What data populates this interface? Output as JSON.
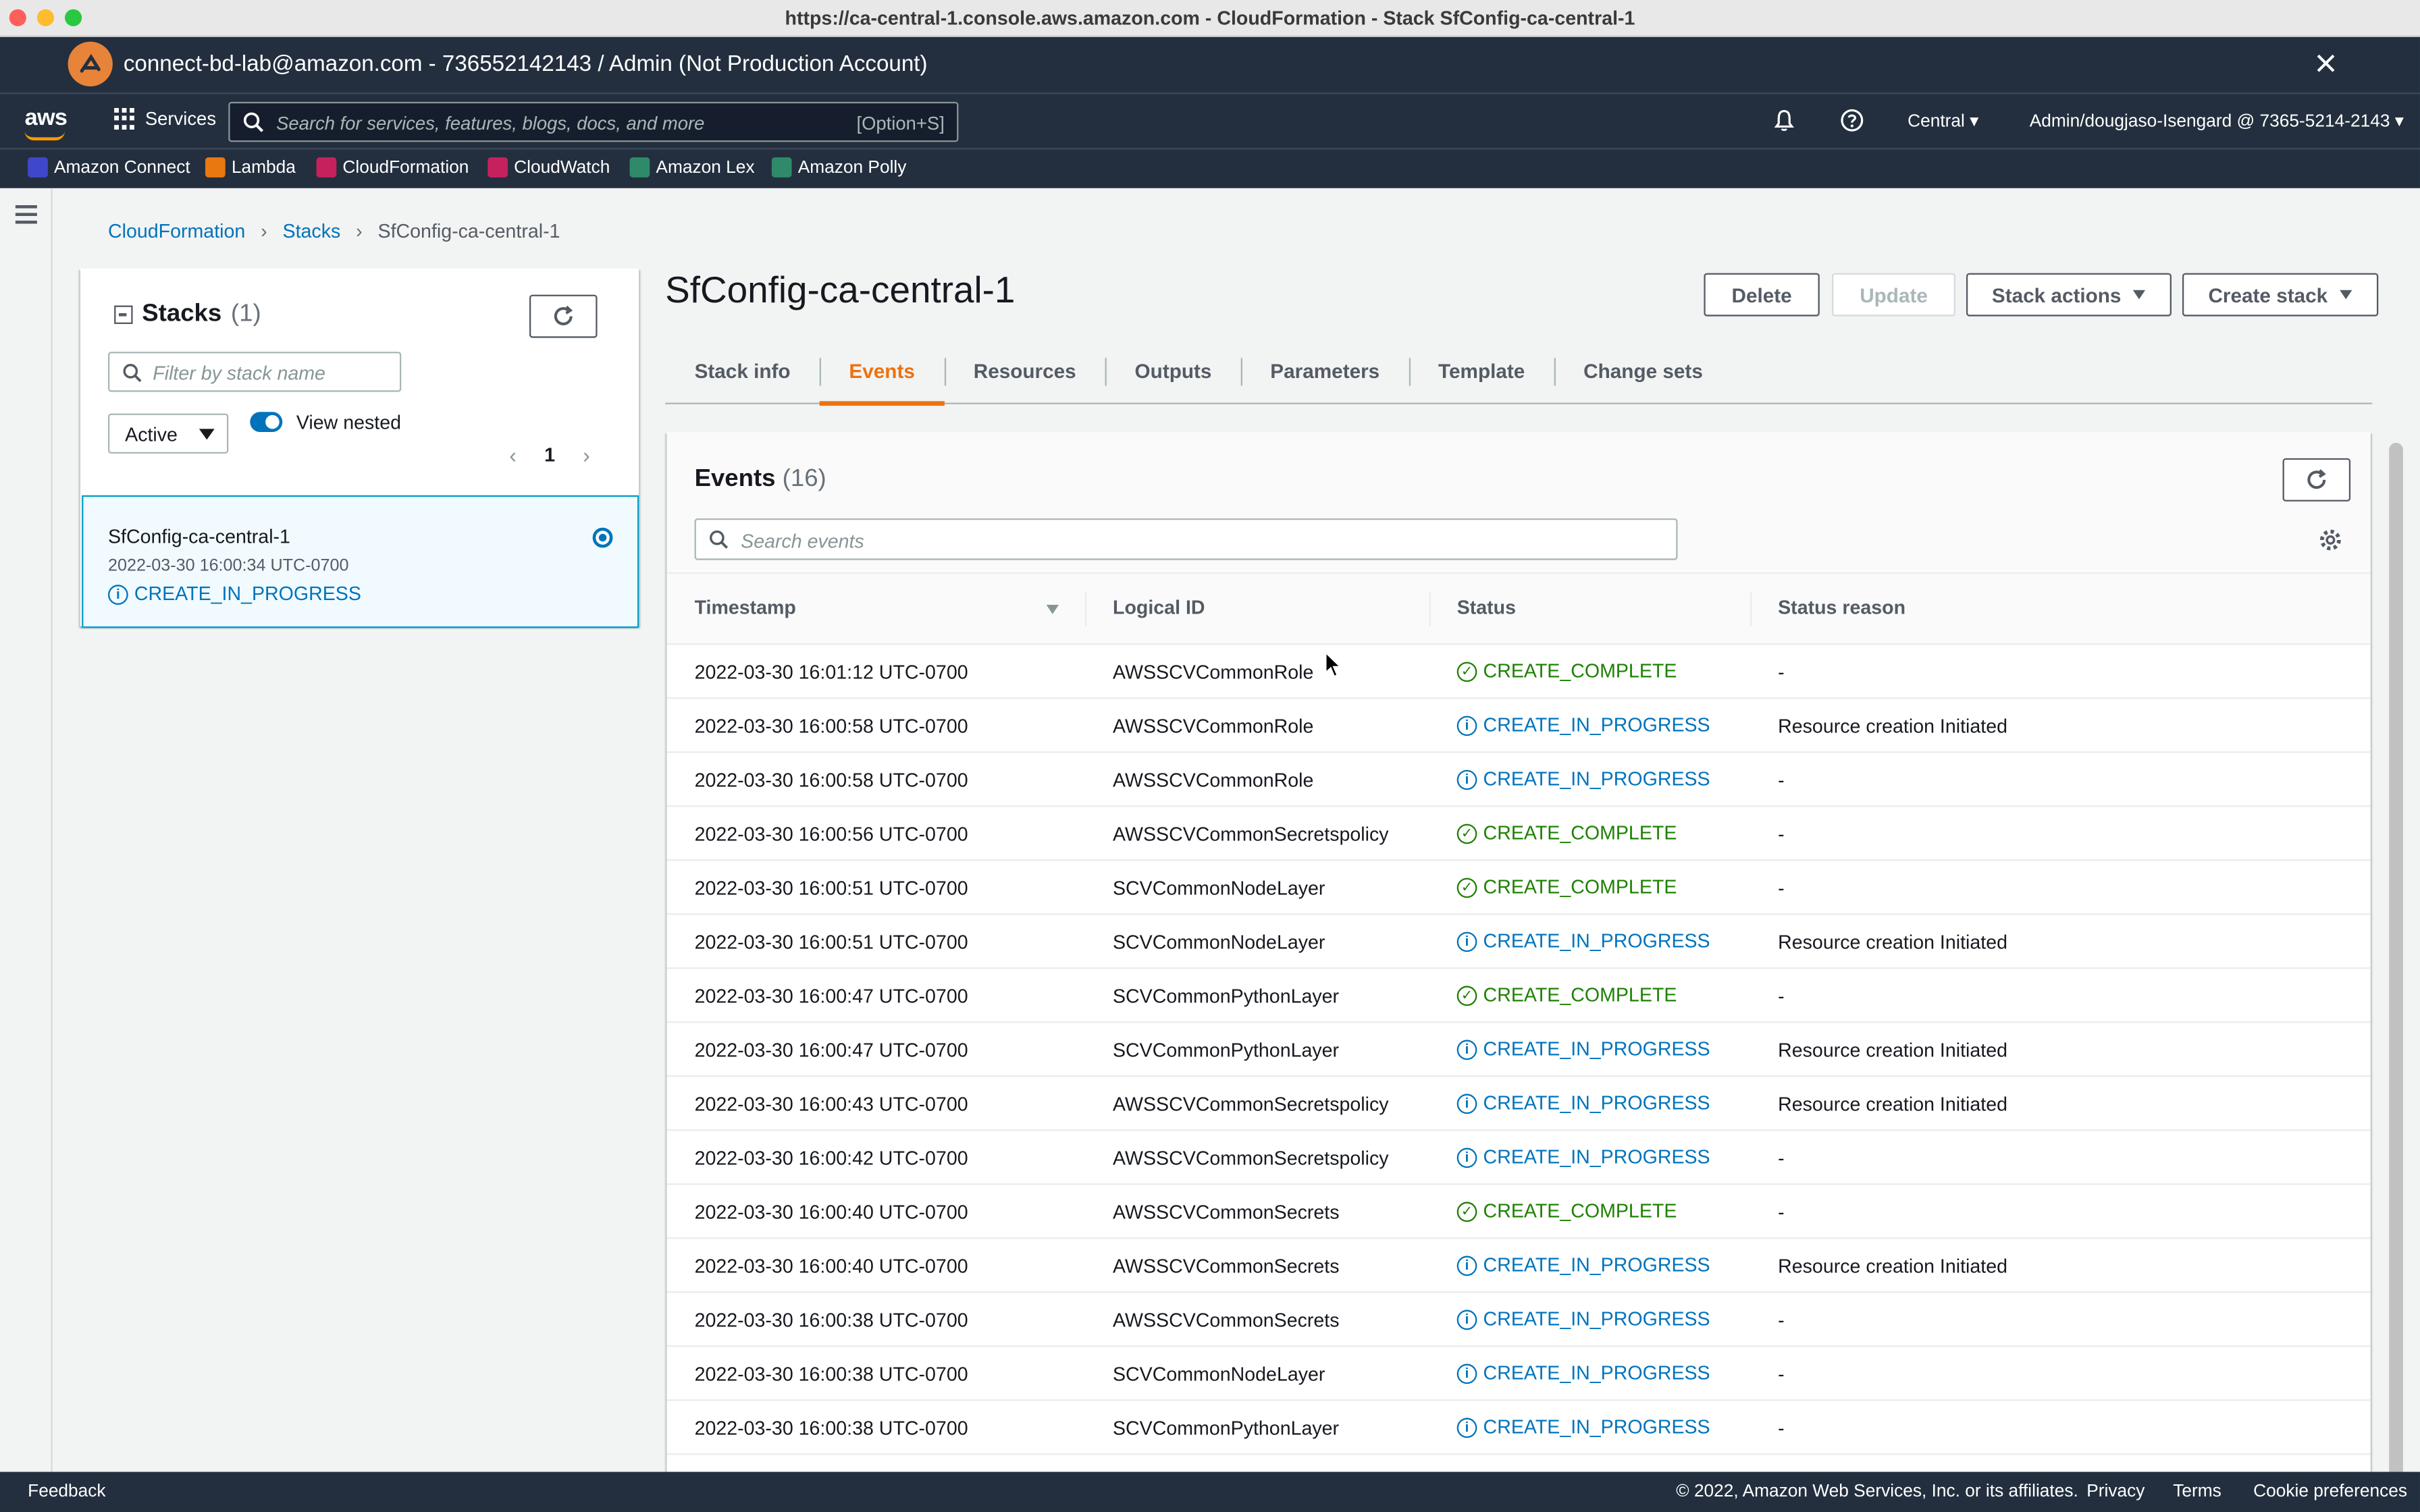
{
  "window": {
    "title": "https://ca-central-1.console.aws.amazon.com - CloudFormation - Stack SfConfig-ca-central-1"
  },
  "isengard": {
    "text": "connect-bd-lab@amazon.com - 736552142143 / Admin (Not Production Account)"
  },
  "nav": {
    "logo": "aws",
    "services": "Services",
    "search_placeholder": "Search for services, features, blogs, docs, and more",
    "search_shortcut": "[Option+S]",
    "region": "Central ▾",
    "account": "Admin/dougjaso-Isengard @ 7365-5214-2143 ▾"
  },
  "favorites": [
    {
      "label": "Amazon Connect",
      "color": "#3f48cc"
    },
    {
      "label": "Lambda",
      "color": "#e8780f"
    },
    {
      "label": "CloudFormation",
      "color": "#c7215d"
    },
    {
      "label": "CloudWatch",
      "color": "#c7215d"
    },
    {
      "label": "Amazon Lex",
      "color": "#2e8a6a"
    },
    {
      "label": "Amazon Polly",
      "color": "#2e8a6a"
    }
  ],
  "breadcrumb": {
    "root": "CloudFormation",
    "stacks": "Stacks",
    "current": "SfConfig-ca-central-1"
  },
  "stacks_panel": {
    "title": "Stacks",
    "count": "(1)",
    "filter_placeholder": "Filter by stack name",
    "filter_value": "Active",
    "toggle_label": "View nested",
    "page": "1",
    "stack": {
      "name": "SfConfig-ca-central-1",
      "date": "2022-03-30 16:00:34 UTC-0700",
      "status": "CREATE_IN_PROGRESS"
    }
  },
  "main": {
    "title": "SfConfig-ca-central-1",
    "buttons": {
      "delete": "Delete",
      "update": "Update",
      "stack_actions": "Stack actions",
      "create_stack": "Create stack"
    },
    "tabs": [
      "Stack info",
      "Events",
      "Resources",
      "Outputs",
      "Parameters",
      "Template",
      "Change sets"
    ],
    "active_tab": "Events"
  },
  "events": {
    "title": "Events",
    "count": "(16)",
    "search_placeholder": "Search events",
    "columns": [
      "Timestamp",
      "Logical ID",
      "Status",
      "Status reason"
    ],
    "rows": [
      {
        "timestamp": "2022-03-30 16:01:12 UTC-0700",
        "logical_id": "AWSSCVCommonRole",
        "status": "CREATE_COMPLETE",
        "reason": "-"
      },
      {
        "timestamp": "2022-03-30 16:00:58 UTC-0700",
        "logical_id": "AWSSCVCommonRole",
        "status": "CREATE_IN_PROGRESS",
        "reason": "Resource creation Initiated"
      },
      {
        "timestamp": "2022-03-30 16:00:58 UTC-0700",
        "logical_id": "AWSSCVCommonRole",
        "status": "CREATE_IN_PROGRESS",
        "reason": "-"
      },
      {
        "timestamp": "2022-03-30 16:00:56 UTC-0700",
        "logical_id": "AWSSCVCommonSecretspolicy",
        "status": "CREATE_COMPLETE",
        "reason": "-"
      },
      {
        "timestamp": "2022-03-30 16:00:51 UTC-0700",
        "logical_id": "SCVCommonNodeLayer",
        "status": "CREATE_COMPLETE",
        "reason": "-"
      },
      {
        "timestamp": "2022-03-30 16:00:51 UTC-0700",
        "logical_id": "SCVCommonNodeLayer",
        "status": "CREATE_IN_PROGRESS",
        "reason": "Resource creation Initiated"
      },
      {
        "timestamp": "2022-03-30 16:00:47 UTC-0700",
        "logical_id": "SCVCommonPythonLayer",
        "status": "CREATE_COMPLETE",
        "reason": "-"
      },
      {
        "timestamp": "2022-03-30 16:00:47 UTC-0700",
        "logical_id": "SCVCommonPythonLayer",
        "status": "CREATE_IN_PROGRESS",
        "reason": "Resource creation Initiated"
      },
      {
        "timestamp": "2022-03-30 16:00:43 UTC-0700",
        "logical_id": "AWSSCVCommonSecretspolicy",
        "status": "CREATE_IN_PROGRESS",
        "reason": "Resource creation Initiated"
      },
      {
        "timestamp": "2022-03-30 16:00:42 UTC-0700",
        "logical_id": "AWSSCVCommonSecretspolicy",
        "status": "CREATE_IN_PROGRESS",
        "reason": "-"
      },
      {
        "timestamp": "2022-03-30 16:00:40 UTC-0700",
        "logical_id": "AWSSCVCommonSecrets",
        "status": "CREATE_COMPLETE",
        "reason": "-"
      },
      {
        "timestamp": "2022-03-30 16:00:40 UTC-0700",
        "logical_id": "AWSSCVCommonSecrets",
        "status": "CREATE_IN_PROGRESS",
        "reason": "Resource creation Initiated"
      },
      {
        "timestamp": "2022-03-30 16:00:38 UTC-0700",
        "logical_id": "AWSSCVCommonSecrets",
        "status": "CREATE_IN_PROGRESS",
        "reason": "-"
      },
      {
        "timestamp": "2022-03-30 16:00:38 UTC-0700",
        "logical_id": "SCVCommonNodeLayer",
        "status": "CREATE_IN_PROGRESS",
        "reason": "-"
      },
      {
        "timestamp": "2022-03-30 16:00:38 UTC-0700",
        "logical_id": "SCVCommonPythonLayer",
        "status": "CREATE_IN_PROGRESS",
        "reason": "-"
      }
    ]
  },
  "footer": {
    "feedback": "Feedback",
    "copyright": "© 2022, Amazon Web Services, Inc. or its affiliates.",
    "links": [
      "Privacy",
      "Terms",
      "Cookie preferences"
    ]
  },
  "colors": {
    "nav_bg": "#232f3e",
    "accent": "#ec7211",
    "link": "#0073bb",
    "success": "#1d8102"
  }
}
